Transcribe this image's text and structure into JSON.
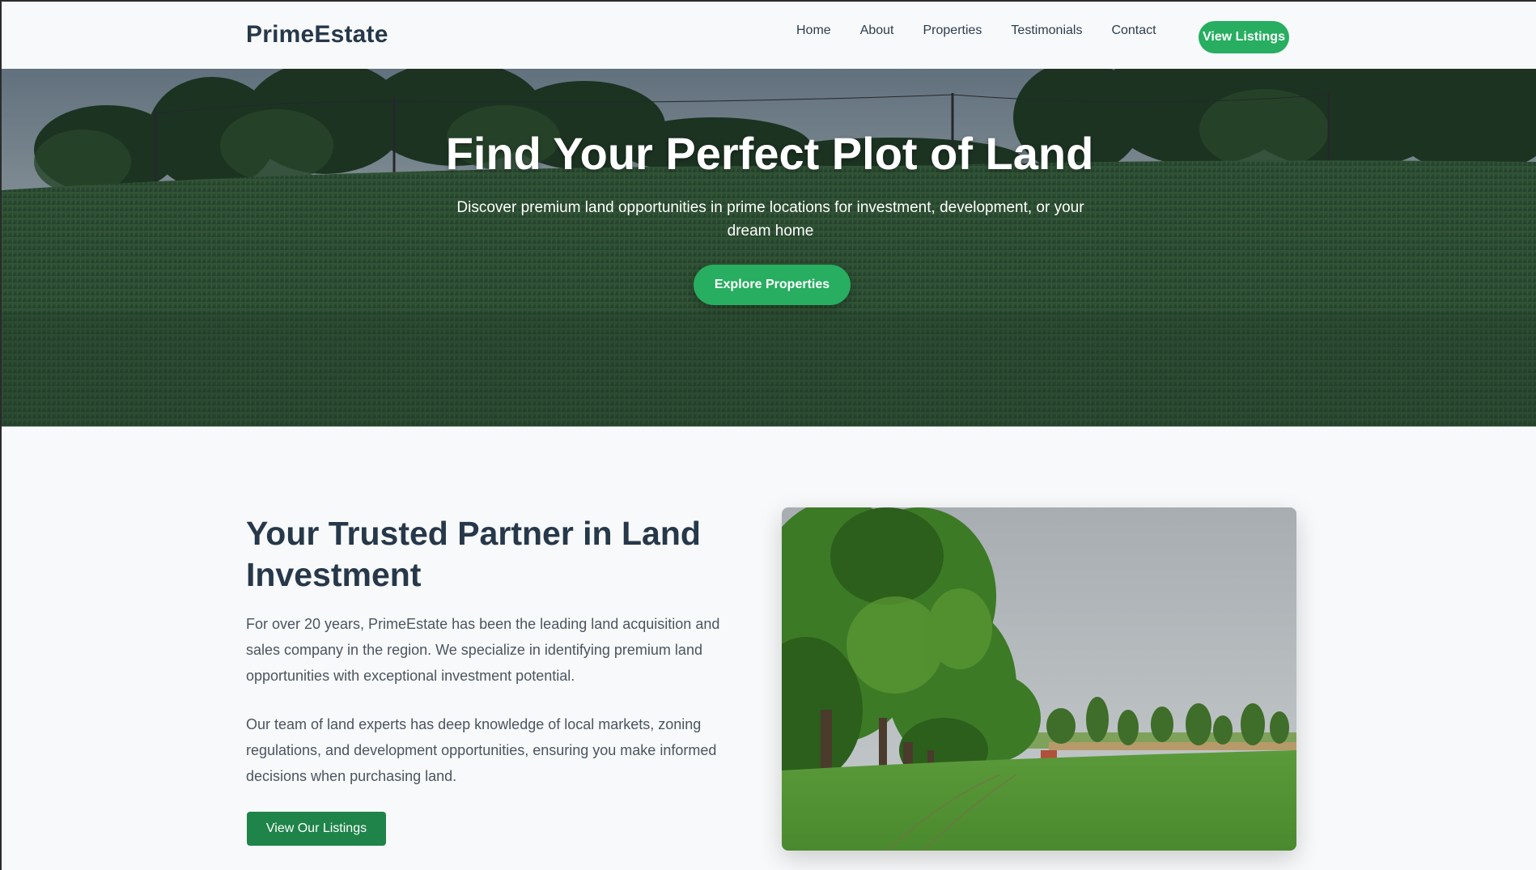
{
  "header": {
    "logo": "PrimeEstate",
    "nav": [
      {
        "label": "Home"
      },
      {
        "label": "About"
      },
      {
        "label": "Properties"
      },
      {
        "label": "Testimonials"
      },
      {
        "label": "Contact"
      }
    ],
    "cta_label": "View Listings"
  },
  "hero": {
    "title": "Find Your Perfect Plot of Land",
    "subtitle": "Discover premium land opportunities in prime locations for investment, development, or your dream home",
    "button_label": "Explore Properties"
  },
  "about": {
    "title": "Your Trusted Partner in Land Investment",
    "paragraph_1": "For over 20 years, PrimeEstate has been the leading land acquisition and sales company in the region. We specialize in identifying premium land opportunities with exceptional investment potential.",
    "paragraph_2": "Our team of land experts has deep knowledge of local markets, zoning regulations, and development opportunities, ensuring you make informed decisions when purchasing land.",
    "button_label": "View Our Listings"
  },
  "colors": {
    "accent_green": "#27ae60",
    "dark_green_button": "#1e8449",
    "heading": "#26384a",
    "body_text": "#4a5560",
    "background": "#f8f9fa"
  }
}
